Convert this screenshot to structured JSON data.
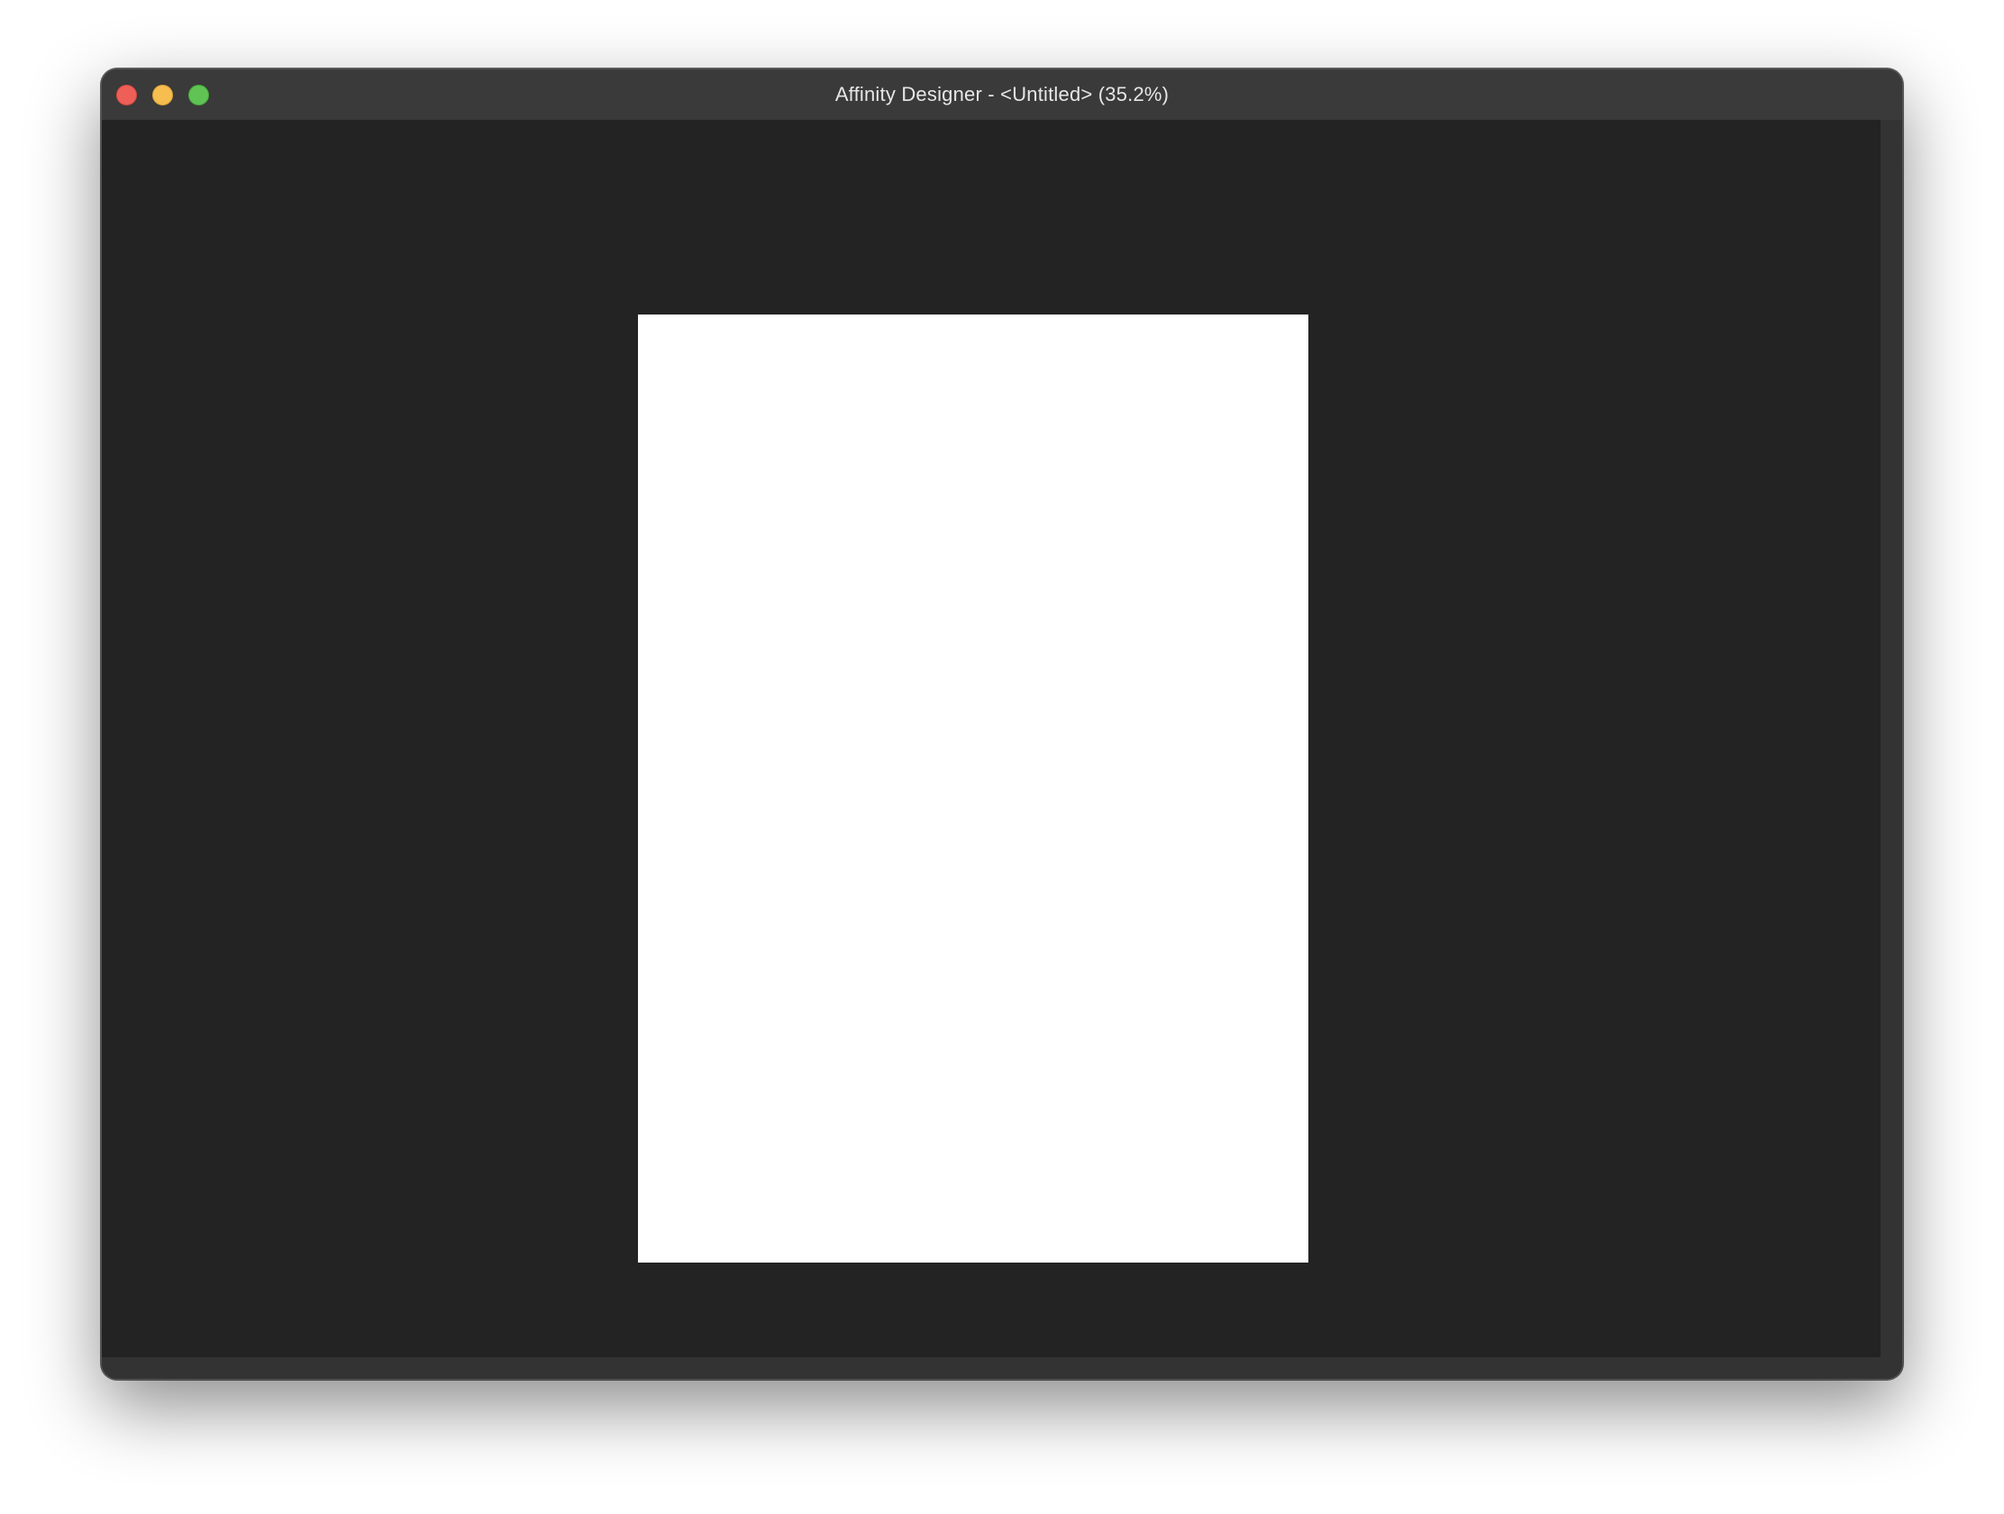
{
  "window": {
    "title": "Affinity Designer - <Untitled> (35.2%)",
    "zoom_level": "35.2%",
    "document_name": "<Untitled>"
  },
  "traffic_lights": {
    "close_color": "#ed5f57",
    "minimize_color": "#f6bd4f",
    "zoom_color": "#5fc454"
  },
  "canvas": {
    "background_color": "#232323",
    "artboard_color": "#ffffff"
  }
}
